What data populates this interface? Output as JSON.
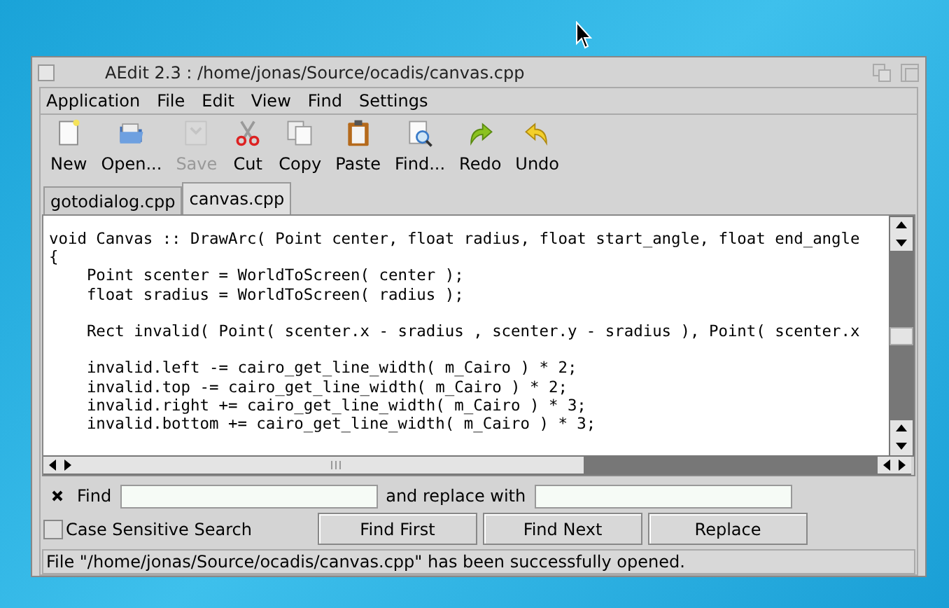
{
  "window": {
    "title": "AEdit 2.3 : /home/jonas/Source/ocadis/canvas.cpp"
  },
  "menu": [
    "Application",
    "File",
    "Edit",
    "View",
    "Find",
    "Settings"
  ],
  "toolbar": [
    {
      "kind": "new",
      "label": "New",
      "disabled": false
    },
    {
      "kind": "open",
      "label": "Open...",
      "disabled": false
    },
    {
      "kind": "save",
      "label": "Save",
      "disabled": true
    },
    {
      "kind": "cut",
      "label": "Cut",
      "disabled": false
    },
    {
      "kind": "copy",
      "label": "Copy",
      "disabled": false
    },
    {
      "kind": "paste",
      "label": "Paste",
      "disabled": false
    },
    {
      "kind": "find",
      "label": "Find...",
      "disabled": false
    },
    {
      "kind": "redo",
      "label": "Redo",
      "disabled": false
    },
    {
      "kind": "undo",
      "label": "Undo",
      "disabled": false
    }
  ],
  "tabs": [
    {
      "label": "gotodialog.cpp",
      "selected": false
    },
    {
      "label": "canvas.cpp",
      "selected": true
    }
  ],
  "editor": {
    "blocks": [
      [
        "void Canvas :: DrawArc( Point center, float radius, float start_angle, float end_angle",
        "{",
        "    Point scenter = WorldToScreen( center );",
        "    float sradius = WorldToScreen( radius );"
      ],
      [
        "    Rect invalid( Point( scenter.x - sradius , scenter.y - sradius ), Point( scenter.x"
      ],
      [
        "    invalid.left -= cairo_get_line_width( m_Cairo ) * 2;",
        "    invalid.top -= cairo_get_line_width( m_Cairo ) * 2;",
        "    invalid.right += cairo_get_line_width( m_Cairo ) * 3;",
        "    invalid.bottom += cairo_get_line_width( m_Cairo ) * 3;"
      ]
    ]
  },
  "find_bar": {
    "find_label": "Find",
    "replace_label": "and replace with",
    "case_sensitive": {
      "label": "Case Sensitive Search",
      "checked": false
    },
    "buttons": [
      "Find First",
      "Find Next",
      "Replace"
    ]
  },
  "status_bar": "File \"/home/jonas/Source/ocadis/canvas.cpp\" has been successfully opened."
}
